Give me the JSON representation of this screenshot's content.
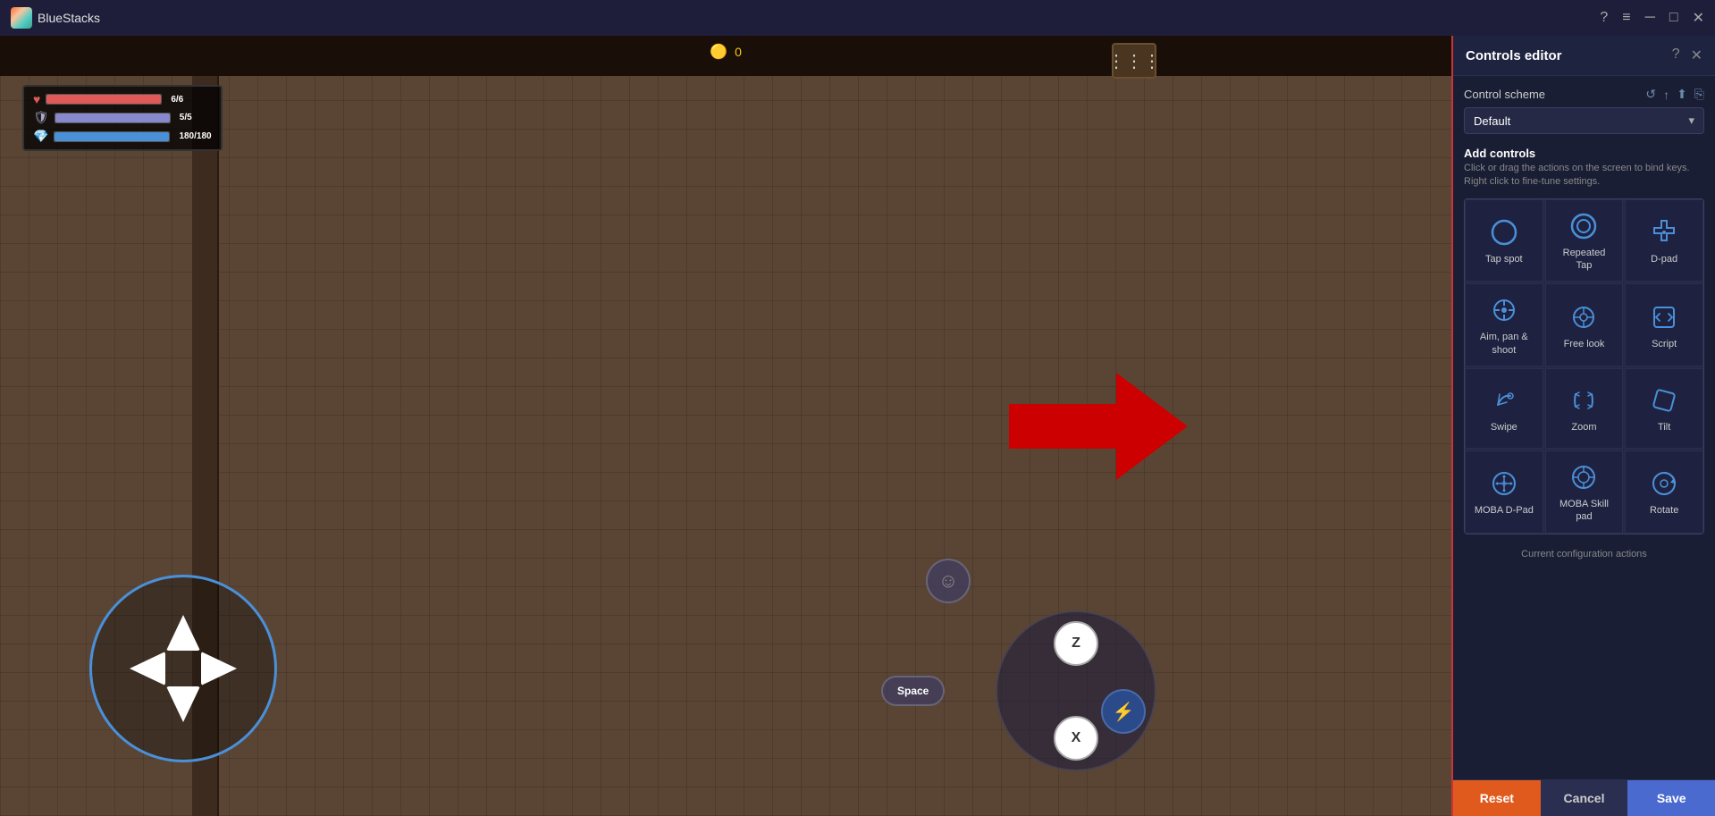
{
  "topbar": {
    "title": "BlueStacks",
    "home_icon": "⌂",
    "multi_icon": "⧉",
    "help_icon": "?",
    "menu_icon": "≡",
    "minimize_icon": "─",
    "maximize_icon": "□",
    "close_icon": "✕"
  },
  "hud": {
    "hp_current": "6",
    "hp_max": "6",
    "mp_current": "5",
    "mp_max": "5",
    "gold_current": "180",
    "gold_max": "180",
    "hp_label": "6/6",
    "mp_label": "5/5",
    "gold_label": "180/180",
    "coin_label": "0"
  },
  "controls": {
    "up": "Up",
    "down": "Down",
    "left": "Left",
    "right": "Right",
    "z_btn": "Z",
    "x_btn": "X",
    "space_btn": "Space"
  },
  "panel": {
    "title": "Controls editor",
    "help_icon": "?",
    "close_icon": "✕",
    "control_scheme_label": "Control scheme",
    "scheme_value": "Default",
    "add_controls_title": "Add controls",
    "add_controls_desc": "Click or drag the actions on the screen to bind keys. Right click to fine-tune settings.",
    "items": [
      {
        "id": "tap-spot",
        "label": "Tap spot",
        "icon": "tap_spot"
      },
      {
        "id": "repeated-tap",
        "label": "Repeated\nTap",
        "icon": "repeated_tap"
      },
      {
        "id": "d-pad",
        "label": "D-pad",
        "icon": "dpad"
      },
      {
        "id": "aim-pan-shoot",
        "label": "Aim, pan &\nshoot",
        "icon": "aim"
      },
      {
        "id": "free-look",
        "label": "Free look",
        "icon": "free_look"
      },
      {
        "id": "script",
        "label": "Script",
        "icon": "script"
      },
      {
        "id": "swipe",
        "label": "Swipe",
        "icon": "swipe"
      },
      {
        "id": "zoom",
        "label": "Zoom",
        "icon": "zoom"
      },
      {
        "id": "tilt",
        "label": "Tilt",
        "icon": "tilt"
      },
      {
        "id": "moba-dpad",
        "label": "MOBA D-Pad",
        "icon": "moba_dpad"
      },
      {
        "id": "moba-skill",
        "label": "MOBA Skill\npad",
        "icon": "moba_skill"
      },
      {
        "id": "rotate",
        "label": "Rotate",
        "icon": "rotate"
      }
    ],
    "current_config_label": "Current configuration actions",
    "btn_reset": "Reset",
    "btn_cancel": "Cancel",
    "btn_save": "Save"
  }
}
